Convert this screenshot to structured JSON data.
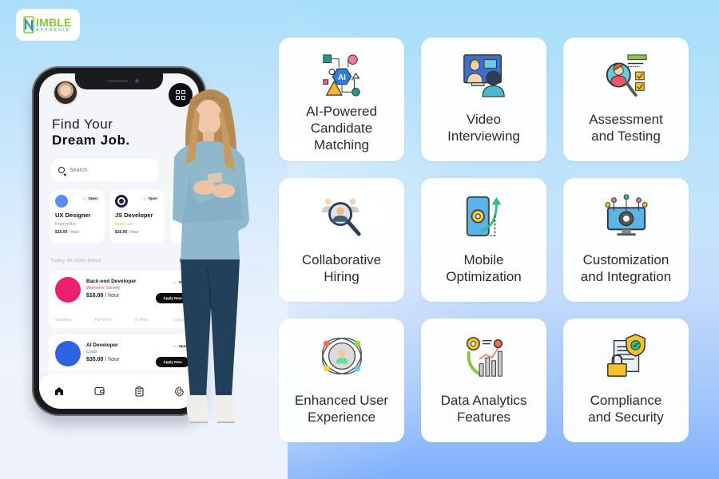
{
  "brand": {
    "logo_main": "IMBLE",
    "logo_sub": "APPGENIE",
    "colors": {
      "green": "#8bc53f",
      "blue": "#2a8cbf"
    }
  },
  "phone": {
    "headline_line1": "Find Your",
    "headline_line2": "Dream Job.",
    "search_placeholder": "Search",
    "featured_jobs": [
      {
        "title": "UX Designer",
        "company": "Paperpillar",
        "company_color": "#8b93f0",
        "rate": "$16.00",
        "unit": "/ hour",
        "status": "Open",
        "logo_color": "#5a8df2"
      },
      {
        "title": "JS Developer",
        "company": "Halo Lab",
        "company_color": "#f5b548",
        "rate": "$16.00",
        "unit": "/ hour",
        "status": "Open",
        "logo_color": "#1b1b3a"
      }
    ],
    "jobs_listed": "Today 98 Jobs listed",
    "see_all": "See all",
    "job_list": [
      {
        "title": "Back-end Developer",
        "company": "Women's Society",
        "company_color": "#ee2b78",
        "rate": "$16.00",
        "unit": "/ hour",
        "status": "Open",
        "apply": "Apply Now",
        "logo_color": "#ee1f6f",
        "meta": [
          "Germany",
          "Full-Time",
          "In-office",
          "1 day ago"
        ]
      },
      {
        "title": "AI Developer",
        "company": "Coub",
        "company_color": "#3a6ee8",
        "rate": "$35.00",
        "unit": "/ hour",
        "status": "Open",
        "apply": "Apply Now",
        "logo_color": "#2d62e0"
      }
    ],
    "tabbar": [
      "home-icon",
      "wallet-icon",
      "clipboard-icon",
      "settings-icon"
    ]
  },
  "features": [
    {
      "label_lines": [
        "AI-Powered",
        "Candidate",
        "Matching"
      ],
      "icon": "ai-network-icon"
    },
    {
      "label_lines": [
        "Video",
        "Interviewing"
      ],
      "icon": "video-call-icon"
    },
    {
      "label_lines": [
        "Assessment",
        "and Testing"
      ],
      "icon": "assessment-icon"
    },
    {
      "label_lines": [
        "Collaborative",
        "Hiring"
      ],
      "icon": "candidate-search-icon"
    },
    {
      "label_lines": [
        "Mobile",
        "Optimization"
      ],
      "icon": "mobile-gear-icon"
    },
    {
      "label_lines": [
        "Customization",
        "and Integration"
      ],
      "icon": "monitor-gear-icon"
    },
    {
      "label_lines": [
        "Enhanced User",
        "Experience"
      ],
      "icon": "user-orbit-icon"
    },
    {
      "label_lines": [
        "Data Analytics",
        "Features"
      ],
      "icon": "analytics-chart-icon"
    },
    {
      "label_lines": [
        "Compliance",
        "and Security"
      ],
      "icon": "security-shield-icon"
    }
  ]
}
